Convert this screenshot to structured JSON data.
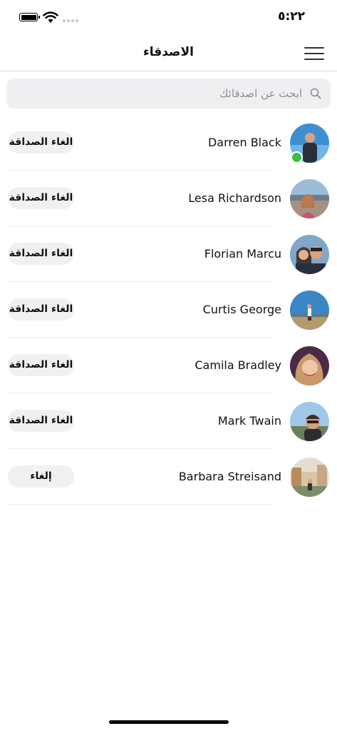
{
  "status_bar": {
    "time": "٥:٢٢"
  },
  "header": {
    "title": "الاصدقاء",
    "menu_icon": "hamburger-menu-icon"
  },
  "search": {
    "placeholder": "ابحث عن اصدقائك",
    "value": "",
    "icon": "search-icon"
  },
  "friends": [
    {
      "name": "Darren Black",
      "action_label": "الغاء الصداقة",
      "online": true
    },
    {
      "name": "Lesa Richardson",
      "action_label": "الغاء الصداقة",
      "online": false
    },
    {
      "name": "Florian Marcu",
      "action_label": "الغاء الصداقة",
      "online": false
    },
    {
      "name": "Curtis George",
      "action_label": "الغاء الصداقة",
      "online": false
    },
    {
      "name": "Camila Bradley",
      "action_label": "الغاء الصداقة",
      "online": false
    },
    {
      "name": "Mark Twain",
      "action_label": "الغاء الصداقة",
      "online": false
    },
    {
      "name": "Barbara Streisand",
      "action_label": "إلغاء",
      "online": false
    }
  ],
  "colors": {
    "online": "#3bbf3b",
    "button_bg": "#f0f0f2",
    "search_bg": "#efeff1"
  }
}
